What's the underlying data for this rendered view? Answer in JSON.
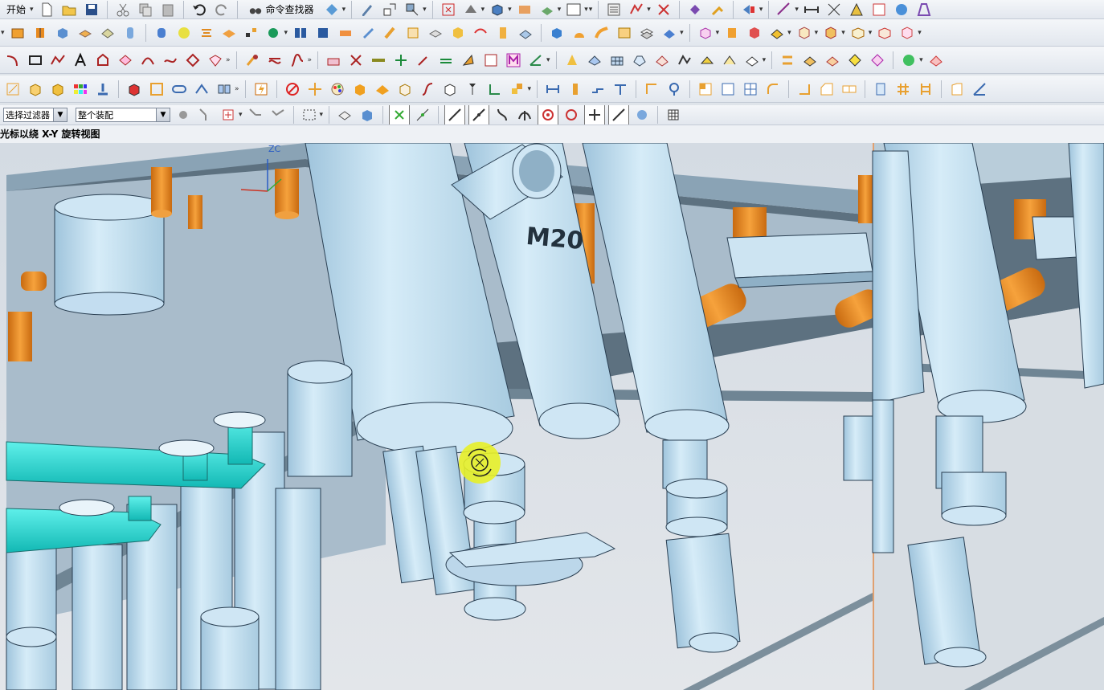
{
  "menu": {
    "start_label": "开始"
  },
  "toolbar": {
    "command_finder_label": "命令查找器",
    "selection_filter": {
      "value": "选择过滤器"
    },
    "assembly_scope": {
      "value": "整个装配"
    }
  },
  "status": {
    "hint": "光标以绕 X-Y 旋转视图"
  },
  "viewport": {
    "axis_label": "ZC",
    "part_label": "M20"
  },
  "colors": {
    "part_fill": "#bfe0f3",
    "part_edge": "#2a3f52",
    "plate_fill": "#9fb4c4",
    "pin_orange": "#e88a1e",
    "water_cyan": "#1fd0cc",
    "cursor_highlight": "#e7f028",
    "background": "#dde1e6"
  }
}
